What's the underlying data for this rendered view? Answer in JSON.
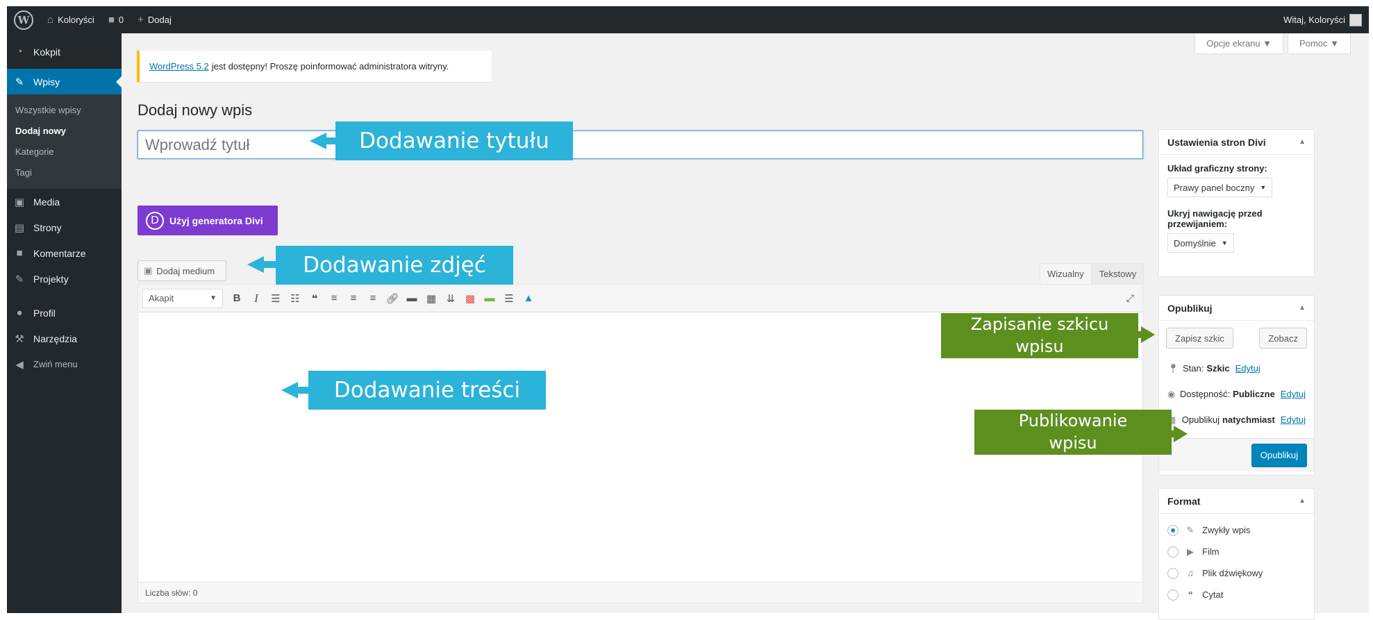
{
  "adminbar": {
    "site_name": "Koloryści",
    "comments_count": "0",
    "add_new": "Dodaj",
    "greeting": "Witaj, Koloryści"
  },
  "sidebar": {
    "items": [
      {
        "label": "Kokpit",
        "icon": "dashboard-icon"
      },
      {
        "label": "Wpisy",
        "icon": "pin-icon"
      },
      {
        "label": "Media",
        "icon": "media-icon"
      },
      {
        "label": "Strony",
        "icon": "pages-icon"
      },
      {
        "label": "Komentarze",
        "icon": "comments-icon"
      },
      {
        "label": "Projekty",
        "icon": "pin-icon"
      },
      {
        "label": "Profil",
        "icon": "user-icon"
      },
      {
        "label": "Narzędzia",
        "icon": "wrench-icon"
      },
      {
        "label": "Zwiń menu",
        "icon": "collapse-icon"
      }
    ],
    "submenu": [
      "Wszystkie wpisy",
      "Dodaj nowy",
      "Kategorie",
      "Tagi"
    ]
  },
  "screen_options": {
    "options_label": "Opcje ekranu ▼",
    "help_label": "Pomoc ▼"
  },
  "notice": {
    "link": "WordPress 5.2",
    "text": "jest dostępny! Proszę poinformować administratora witryny."
  },
  "page_title": "Dodaj nowy wpis",
  "title_input": {
    "placeholder": "Wprowadź tytuł"
  },
  "divi_button": "Użyj generatora Divi",
  "divi_logo": "D",
  "add_media": "Dodaj medium",
  "editor_tabs": {
    "visual": "Wizualny",
    "text": "Tekstowy"
  },
  "format_select": "Akapit",
  "word_count": "Liczba słów: 0",
  "divi_settings": {
    "title": "Ustawienia stron Divi",
    "layout_label": "Układ graficzny strony:",
    "layout_value": "Prawy panel boczny",
    "nav_label": "Ukryj nawigację przed przewijaniem:",
    "nav_value": "Domyślnie"
  },
  "publish": {
    "title": "Opublikuj",
    "save_draft": "Zapisz szkic",
    "preview": "Zobacz",
    "status_label": "Stan:",
    "status_value": "Szkic",
    "visibility_label": "Dostępność:",
    "visibility_value": "Publiczne",
    "schedule_label": "Opublikuj",
    "schedule_value": "natychmiast",
    "edit": "Edytuj",
    "publish_button": "Opublikuj"
  },
  "format_box": {
    "title": "Format",
    "options": [
      "Zwykły wpis",
      "Film",
      "Plik dźwiękowy",
      "Cytat"
    ]
  },
  "annotations": {
    "title": "Dodawanie tytułu",
    "images": "Dodawanie zdjęć",
    "content": "Dodawanie treści",
    "draft_line1": "Zapisanie szkicu",
    "draft_line2": "wpisu",
    "publish_line1": "Publikowanie",
    "publish_line2": "wpisu"
  },
  "colors": {
    "admin_dark": "#23282d",
    "accent_blue": "#0073aa",
    "divi_purple": "#7e3bd0",
    "callout_cyan": "#2bb3d9",
    "callout_green": "#5d8f1f"
  }
}
